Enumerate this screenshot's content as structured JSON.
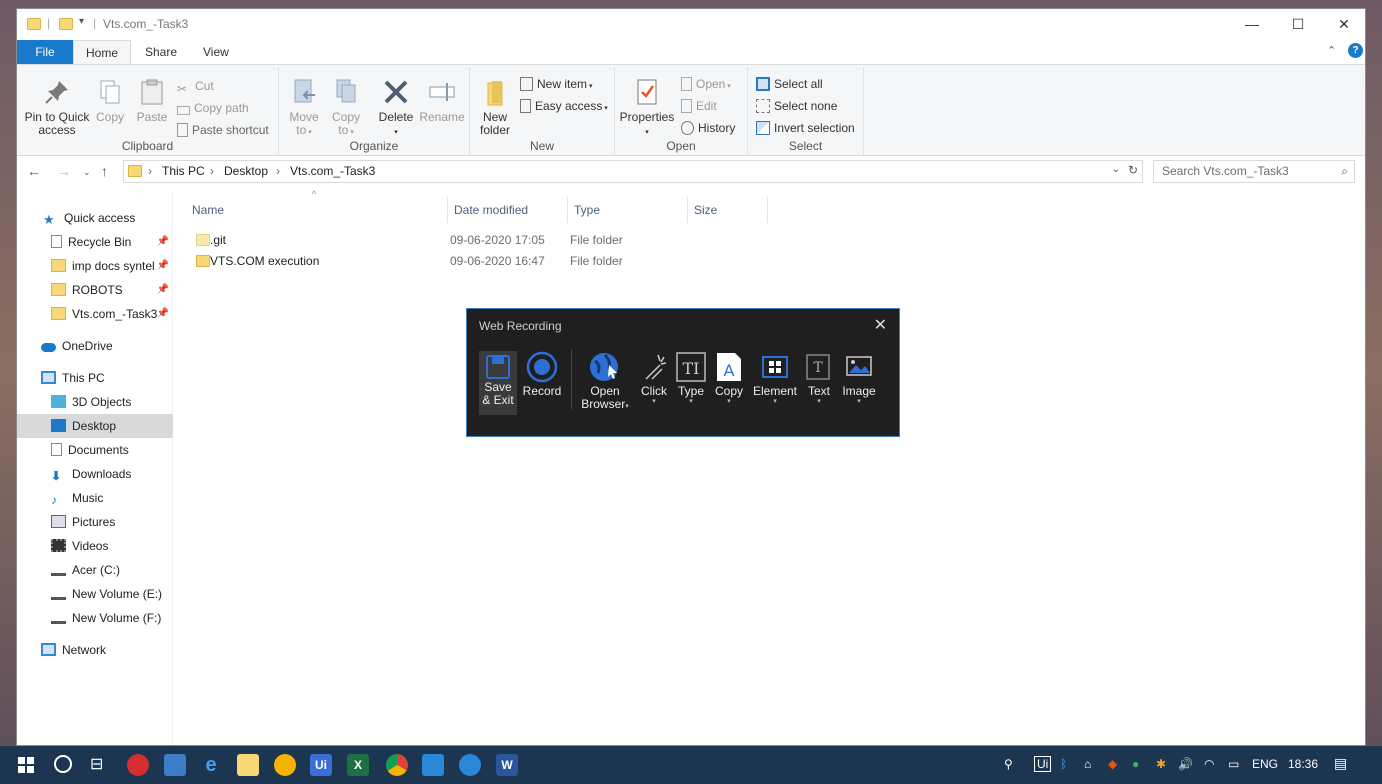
{
  "window": {
    "title": "Vts.com_-Task3",
    "controls": {
      "minimize": "—",
      "maximize": "☐",
      "close": "✕"
    }
  },
  "ribbon_tabs": [
    "File",
    "Home",
    "Share",
    "View"
  ],
  "ribbon": {
    "clipboard": {
      "group": "Clipboard",
      "pin_to_quick_access_1": "Pin to Quick",
      "pin_to_quick_access_2": "access",
      "copy": "Copy",
      "paste": "Paste",
      "cut": "Cut",
      "copy_path": "Copy path",
      "paste_shortcut": "Paste shortcut"
    },
    "organize": {
      "group": "Organize",
      "move_to_1": "Move",
      "move_to_2": "to",
      "copy_to_1": "Copy",
      "copy_to_2": "to",
      "delete": "Delete",
      "rename": "Rename"
    },
    "new": {
      "group": "New",
      "new_folder_1": "New",
      "new_folder_2": "folder",
      "new_item": "New item",
      "easy_access": "Easy access"
    },
    "open": {
      "group": "Open",
      "properties": "Properties",
      "open": "Open",
      "edit": "Edit",
      "history": "History"
    },
    "select": {
      "group": "Select",
      "select_all": "Select all",
      "select_none": "Select none",
      "invert_selection": "Invert selection"
    }
  },
  "address": {
    "crumbs": [
      "This PC",
      "Desktop",
      "Vts.com_-Task3"
    ],
    "search_placeholder": "Search Vts.com_-Task3"
  },
  "sidebar": {
    "quick_access": "Quick access",
    "pinned": [
      "Recycle Bin",
      "imp docs syntel",
      "ROBOTS",
      "Vts.com_-Task3"
    ],
    "onedrive": "OneDrive",
    "this_pc": "This PC",
    "pc_items": [
      "3D Objects",
      "Desktop",
      "Documents",
      "Downloads",
      "Music",
      "Pictures",
      "Videos",
      "Acer (C:)",
      "New Volume (E:)",
      "New Volume (F:)"
    ],
    "network": "Network"
  },
  "columns": [
    "Name",
    "Date modified",
    "Type",
    "Size"
  ],
  "files": [
    {
      "name": ".git",
      "date": "09-06-2020 17:05",
      "type": "File folder"
    },
    {
      "name": "VTS.COM execution",
      "date": "09-06-2020 16:47",
      "type": "File folder"
    }
  ],
  "recorder": {
    "title": "Web Recording",
    "tools": {
      "save_1": "Save",
      "save_2": "& Exit",
      "record": "Record",
      "open_1": "Open",
      "open_2": "Browser",
      "click": "Click",
      "type": "Type",
      "copy": "Copy",
      "element": "Element",
      "text": "Text",
      "image": "Image"
    }
  },
  "taskbar": {
    "lang": "ENG",
    "time": "18:36"
  },
  "colors": {
    "accent": "#1979ca",
    "folder": "#f8d775",
    "taskbar": "#1c3550",
    "dialog": "#1f1f1f"
  }
}
